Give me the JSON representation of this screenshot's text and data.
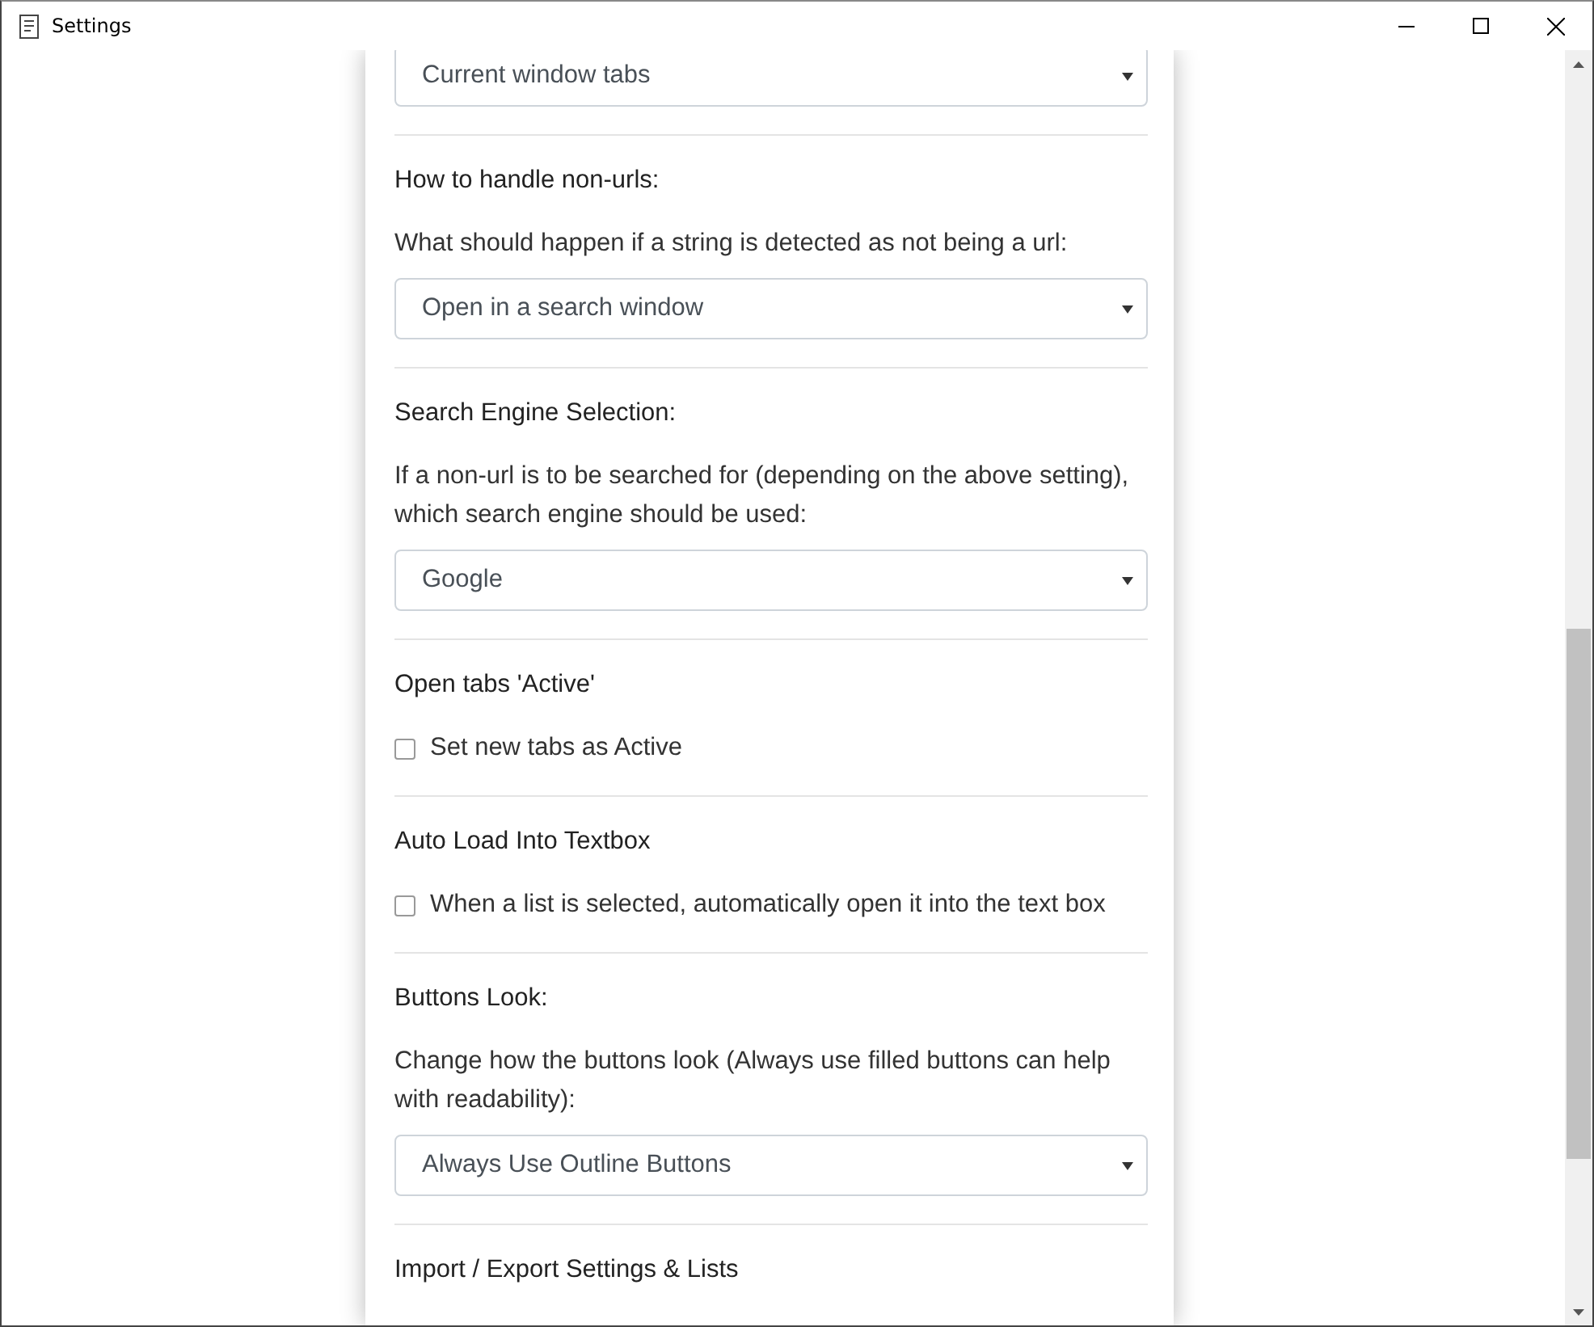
{
  "window": {
    "title": "Settings"
  },
  "sections": [
    {
      "kind": "select",
      "value": "Current window tabs"
    },
    {
      "kind": "select",
      "heading": "How to handle non-urls:",
      "description": "What should happen if a string is detected as not being a url:",
      "value": "Open in a search window"
    },
    {
      "kind": "select",
      "heading": "Search Engine Selection:",
      "description": "If a non-url is to be searched for (depending on the above setting), which search engine should be used:",
      "value": "Google"
    },
    {
      "kind": "checkbox",
      "heading": "Open tabs 'Active'",
      "label": "Set new tabs as Active",
      "checked": false
    },
    {
      "kind": "checkbox",
      "heading": "Auto Load Into Textbox",
      "label": "When a list is selected, automatically open it into the text box",
      "checked": false
    },
    {
      "kind": "select",
      "heading": "Buttons Look:",
      "description": "Change how the buttons look (Always use filled buttons can help with readability):",
      "value": "Always Use Outline Buttons"
    },
    {
      "kind": "heading",
      "heading": "Import / Export Settings & Lists"
    }
  ]
}
